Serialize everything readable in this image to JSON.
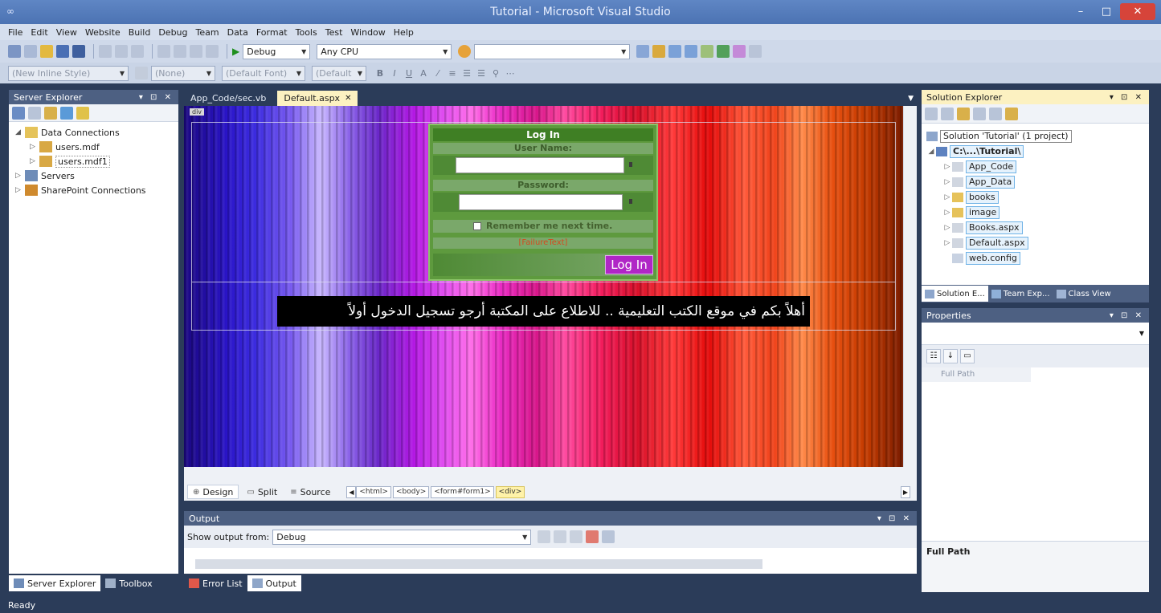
{
  "window": {
    "title": "Tutorial - Microsoft Visual Studio",
    "minimize": "–",
    "maximize": "□",
    "close": "✕"
  },
  "menu": [
    "File",
    "Edit",
    "View",
    "Website",
    "Build",
    "Debug",
    "Team",
    "Data",
    "Format",
    "Tools",
    "Test",
    "Window",
    "Help"
  ],
  "toolbar": {
    "config": "Debug",
    "platform": "Any CPU",
    "search": "",
    "style_combo": "(New Inline Style)",
    "block_combo": "(None)",
    "font_combo": "(Default Font)",
    "size_combo": "(Default"
  },
  "server_explorer": {
    "title": "Server Explorer",
    "controls": "▾ ⊡ ✕",
    "items": [
      {
        "label": "Data Connections",
        "expanded": true
      },
      {
        "label": "users.mdf"
      },
      {
        "label": "users.mdf1"
      },
      {
        "label": "Servers"
      },
      {
        "label": "SharePoint Connections"
      }
    ]
  },
  "left_bottom_tabs": [
    "Server Explorer",
    "Toolbox"
  ],
  "doc_tabs": [
    {
      "label": "App_Code/sec.vb"
    },
    {
      "label": "Default.aspx",
      "close": "✕"
    }
  ],
  "design": {
    "div_tag": "div",
    "login": {
      "header": "Log In",
      "user_label": "User Name:",
      "password_label": "Password:",
      "remember": "Remember me next time.",
      "failure": "[FailureText]",
      "button": "Log In"
    },
    "welcome": "أهلاً بكم في موقع الكتب التعليمية .. للاطلاع على المكتبة أرجو تسجيل الدخول أولاً"
  },
  "view_bar": {
    "design": "Design",
    "split": "Split",
    "source": "Source",
    "crumbs": [
      "<html>",
      "<body>",
      "<form#form1>",
      "<div>"
    ]
  },
  "output": {
    "title": "Output",
    "show_from_label": "Show output from:",
    "show_from_value": "Debug"
  },
  "bottom_tabs": [
    "Error List",
    "Output"
  ],
  "solution_explorer": {
    "title": "Solution Explorer",
    "solution": "Solution 'Tutorial' (1 project)",
    "project": "C:\\...\\Tutorial\\",
    "items": [
      "App_Code",
      "App_Data",
      "books",
      "image",
      "Books.aspx",
      "Default.aspx",
      "web.config"
    ]
  },
  "solution_tabs": [
    "Solution E...",
    "Team Exp...",
    "Class View"
  ],
  "properties": {
    "title": "Properties",
    "row_name": "Full Path",
    "desc_title": "Full Path"
  },
  "status": "Ready",
  "colors": {
    "accent": "#4d6082",
    "active_tab": "#fcf1c1",
    "chrome": "#2b3c59"
  }
}
